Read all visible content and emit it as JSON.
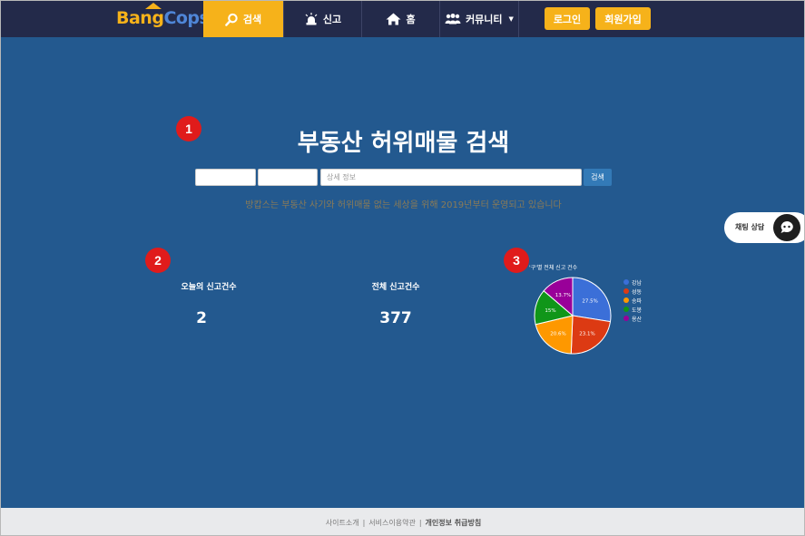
{
  "nav": {
    "logo_part1": "Bang",
    "logo_part2": "Cops",
    "search": "검색",
    "report": "신고",
    "home": "홈",
    "community": "커뮤니티",
    "login": "로그인",
    "signup": "회원가입"
  },
  "main": {
    "title": "부동산 허위매물 검색",
    "detail_placeholder": "상세 정보",
    "search_button": "검색",
    "subtitle": "방캅스는 부동산 사기와 허위매물 없는 세상을 위해 2019년부터 운영되고 있습니다",
    "badges": [
      "1",
      "2",
      "3"
    ],
    "stats": {
      "today_label": "오늘의 신고건수",
      "today_value": "2",
      "total_label": "전체 신고건수",
      "total_value": "377"
    }
  },
  "chat": {
    "label": "채팅 상담"
  },
  "footer": {
    "about": "사이트소개",
    "sep": "|",
    "terms": "서비스이용약관",
    "privacy": "개인정보 취급방침"
  },
  "colors": {
    "nav_bg": "#232a4a",
    "accent": "#f6b21a",
    "main_bg": "#23598f",
    "badge": "#e01b1b"
  },
  "chart_data": {
    "type": "pie",
    "title": "'구'별 전체 신고 건수",
    "categories": [
      "강남",
      "성동",
      "송파",
      "도봉",
      "용산"
    ],
    "values": [
      27.5,
      23.1,
      20.6,
      15,
      13.7
    ],
    "value_labels": [
      "27.5%",
      "23.1%",
      "20.6%",
      "15%",
      "13.7%"
    ],
    "colors": [
      "#3b6fd8",
      "#dc3a13",
      "#fe9800",
      "#109619",
      "#990099"
    ],
    "legend": "right"
  }
}
